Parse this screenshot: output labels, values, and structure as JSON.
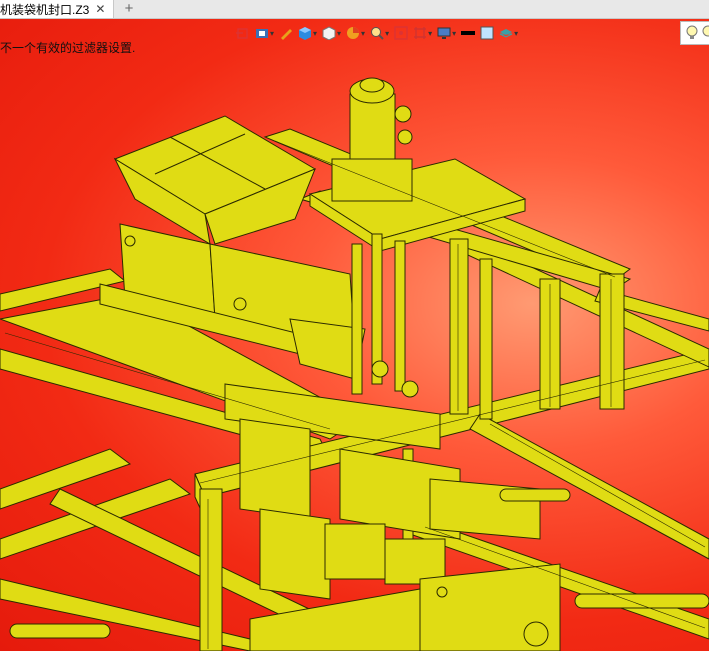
{
  "tab": {
    "title": "机装袋机封口.Z3",
    "close": "✕",
    "add": "+"
  },
  "status": {
    "message": "不一个有效的过滤器设置."
  },
  "toolbar": {
    "icons": [
      "select-filter-icon",
      "view-render-icon",
      "pen-icon",
      "shaded-cube-icon",
      "wire-cube-icon",
      "pie-view-icon",
      "zoom-icon",
      "fit-icon",
      "frame-icon",
      "display-icon",
      "line-color-icon",
      "fill-color-icon",
      "layer-icon",
      "light-bulb-icon"
    ]
  },
  "colors": {
    "background_start": "#ff9a72",
    "background_end": "#e51a0c",
    "model": "#e0dc14",
    "edge": "#2b2a00"
  }
}
